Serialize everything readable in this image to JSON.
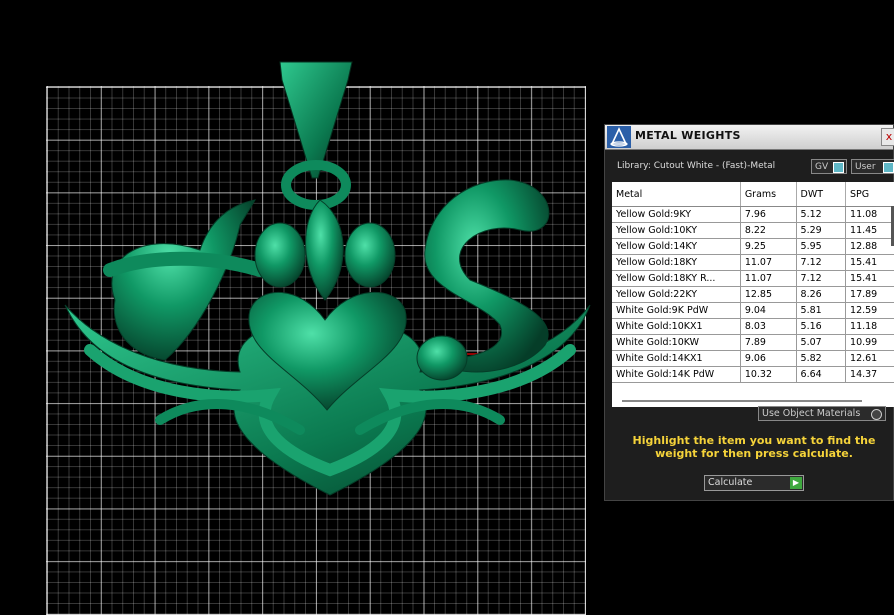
{
  "panel": {
    "title": "METAL WEIGHTS",
    "close_label": "x",
    "library_label": "Library: Cutout White - (Fast)-Metal",
    "gv_label": "GV",
    "user_label": "User",
    "columns": [
      "Metal",
      "Grams",
      "DWT",
      "SPG"
    ],
    "rows": [
      [
        "Yellow Gold:9KY",
        "7.96",
        "5.12",
        "11.08"
      ],
      [
        "Yellow Gold:10KY",
        "8.22",
        "5.29",
        "11.45"
      ],
      [
        "Yellow Gold:14KY",
        "9.25",
        "5.95",
        "12.88"
      ],
      [
        "Yellow Gold:18KY",
        "11.07",
        "7.12",
        "15.41"
      ],
      [
        "Yellow Gold:18KY R...",
        "11.07",
        "7.12",
        "15.41"
      ],
      [
        "Yellow Gold:22KY",
        "12.85",
        "8.26",
        "17.89"
      ],
      [
        "White Gold:9K PdW",
        "9.04",
        "5.81",
        "12.59"
      ],
      [
        "White Gold:10KX1",
        "8.03",
        "5.16",
        "11.18"
      ],
      [
        "White Gold:10KW",
        "7.89",
        "5.07",
        "10.99"
      ],
      [
        "White Gold:14KX1",
        "9.06",
        "5.82",
        "12.61"
      ],
      [
        "White Gold:14K PdW",
        "10.32",
        "6.64",
        "14.37"
      ]
    ],
    "object_materials_label": "Use Object Materials",
    "instruction": "Highlight the item you want to find the weight for then press calculate.",
    "calculate_label": "Calculate"
  },
  "colors": {
    "model_green": "#0e8a5c",
    "instruction_yellow": "#f5d33a",
    "background": "#000000"
  }
}
